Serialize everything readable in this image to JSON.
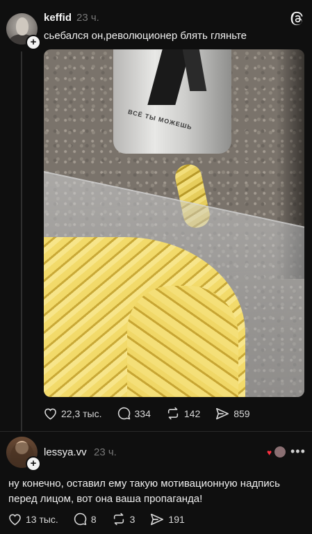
{
  "post": {
    "username": "keffid",
    "time": "23 ч.",
    "caption": "сьебался он,революционер блять гляньте",
    "image_text": "ВСЁ ТЫ МОЖЕШЬ",
    "actions": {
      "likes": "22,3 тыс.",
      "comments": "334",
      "reposts": "142",
      "shares": "859"
    }
  },
  "reply": {
    "username": "lessya.vv",
    "time": "23 ч.",
    "text": "ну конечно, оставил ему такую мотивационную надпись перед лицом, вот она ваша пропаганда!",
    "actions": {
      "likes": "13 тыс.",
      "comments": "8",
      "reposts": "3",
      "shares": "191"
    }
  },
  "icons": [
    "threads-logo-icon",
    "plus-icon",
    "heart-icon",
    "comment-icon",
    "repost-icon",
    "share-icon",
    "more-icon"
  ],
  "colors": {
    "background": "#0f0f0f",
    "text": "#f3f3f3",
    "muted": "#777777",
    "heart": "#ff3040"
  }
}
